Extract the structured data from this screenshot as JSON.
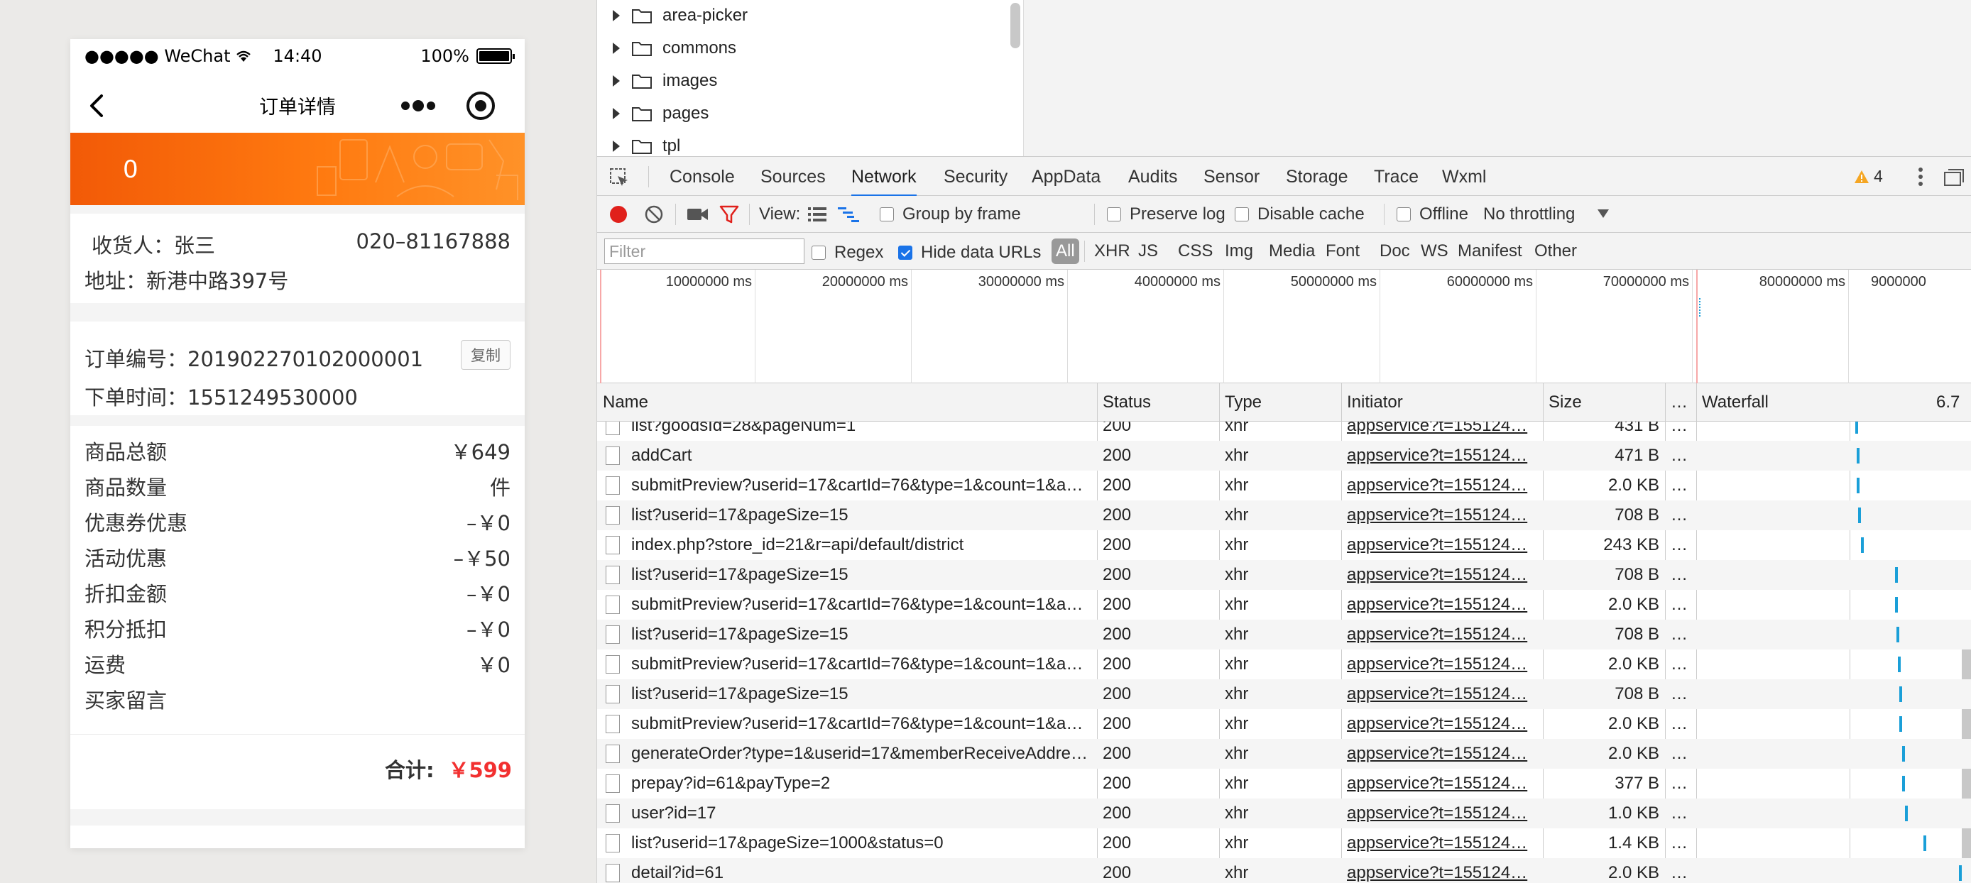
{
  "phone": {
    "carrier": "●●●●● WeChat",
    "time": "14:40",
    "battery_percent": "100%",
    "battery_level": 1.0,
    "nav_title": "订单详情",
    "banner_value": "0",
    "receiver_label": "收货人：张三",
    "receiver_phone": "020–81167888",
    "address": "地址：新港中路397号",
    "order_no": "订单编号：201902270102000001",
    "copy_button": "复制",
    "order_time": "下单时间：1551249530000",
    "summary": [
      {
        "label": "商品总额",
        "value": "￥649"
      },
      {
        "label": "商品数量",
        "value": "件"
      },
      {
        "label": "优惠券优惠",
        "value": "–￥0"
      },
      {
        "label": "活动优惠",
        "value": "–￥50"
      },
      {
        "label": "折扣金额",
        "value": "–￥0"
      },
      {
        "label": "积分抵扣",
        "value": "–￥0"
      },
      {
        "label": "运费",
        "value": "￥0"
      },
      {
        "label": "买家留言",
        "value": ""
      }
    ],
    "total_label": "合计:",
    "total_value": "￥599",
    "accent_color": "#f25a07",
    "price_color": "#f23030"
  },
  "devtools": {
    "file_tree": [
      {
        "name": "area-picker",
        "icon": "folder-icon"
      },
      {
        "name": "commons",
        "icon": "folder-icon"
      },
      {
        "name": "images",
        "icon": "folder-icon"
      },
      {
        "name": "pages",
        "icon": "folder-icon"
      },
      {
        "name": "tpl",
        "icon": "folder-icon"
      }
    ],
    "tabs": [
      "Console",
      "Sources",
      "Network",
      "Security",
      "AppData",
      "Audits",
      "Sensor",
      "Storage",
      "Trace",
      "Wxml"
    ],
    "active_tab": "Network",
    "warning_count": "4",
    "toolbar": {
      "view_label": "View:",
      "group_by_frame": "Group by frame",
      "preserve_log": "Preserve log",
      "disable_cache": "Disable cache",
      "offline": "Offline",
      "throttling": "No throttling"
    },
    "filter": {
      "placeholder": "Filter",
      "regex": "Regex",
      "hide_data_urls": "Hide data URLs",
      "hide_data_urls_checked": true,
      "types": [
        "All",
        "XHR",
        "JS",
        "CSS",
        "Img",
        "Media",
        "Font",
        "Doc",
        "WS",
        "Manifest",
        "Other"
      ]
    },
    "overview_ticks": [
      "10000000 ms",
      "20000000 ms",
      "30000000 ms",
      "40000000 ms",
      "50000000 ms",
      "60000000 ms",
      "70000000 ms",
      "80000000 ms",
      "9000000"
    ],
    "columns": {
      "name": "Name",
      "status": "Status",
      "type": "Type",
      "initiator": "Initiator",
      "size": "Size",
      "time": "…",
      "waterfall": "Waterfall",
      "waterfall_value": "6.7"
    },
    "requests": [
      {
        "name": "list?goodsId=28&pageNum=1",
        "status": "200",
        "type": "xhr",
        "initiator": "appservice?t=155124…",
        "size": "431 B",
        "time": "…"
      },
      {
        "name": "addCart",
        "status": "200",
        "type": "xhr",
        "initiator": "appservice?t=155124…",
        "size": "471 B",
        "time": "…"
      },
      {
        "name": "submitPreview?userid=17&cartId=76&type=1&count=1&a…",
        "status": "200",
        "type": "xhr",
        "initiator": "appservice?t=155124…",
        "size": "2.0 KB",
        "time": "…"
      },
      {
        "name": "list?userid=17&pageSize=15",
        "status": "200",
        "type": "xhr",
        "initiator": "appservice?t=155124…",
        "size": "708 B",
        "time": "…"
      },
      {
        "name": "index.php?store_id=21&r=api/default/district",
        "status": "200",
        "type": "xhr",
        "initiator": "appservice?t=155124…",
        "size": "243 KB",
        "time": "…"
      },
      {
        "name": "list?userid=17&pageSize=15",
        "status": "200",
        "type": "xhr",
        "initiator": "appservice?t=155124…",
        "size": "708 B",
        "time": "…"
      },
      {
        "name": "submitPreview?userid=17&cartId=76&type=1&count=1&a…",
        "status": "200",
        "type": "xhr",
        "initiator": "appservice?t=155124…",
        "size": "2.0 KB",
        "time": "…"
      },
      {
        "name": "list?userid=17&pageSize=15",
        "status": "200",
        "type": "xhr",
        "initiator": "appservice?t=155124…",
        "size": "708 B",
        "time": "…"
      },
      {
        "name": "submitPreview?userid=17&cartId=76&type=1&count=1&a…",
        "status": "200",
        "type": "xhr",
        "initiator": "appservice?t=155124…",
        "size": "2.0 KB",
        "time": "…"
      },
      {
        "name": "list?userid=17&pageSize=15",
        "status": "200",
        "type": "xhr",
        "initiator": "appservice?t=155124…",
        "size": "708 B",
        "time": "…"
      },
      {
        "name": "submitPreview?userid=17&cartId=76&type=1&count=1&a…",
        "status": "200",
        "type": "xhr",
        "initiator": "appservice?t=155124…",
        "size": "2.0 KB",
        "time": "…"
      },
      {
        "name": "generateOrder?type=1&userid=17&memberReceiveAddre…",
        "status": "200",
        "type": "xhr",
        "initiator": "appservice?t=155124…",
        "size": "2.0 KB",
        "time": "…"
      },
      {
        "name": "prepay?id=61&payType=2",
        "status": "200",
        "type": "xhr",
        "initiator": "appservice?t=155124…",
        "size": "377 B",
        "time": "…"
      },
      {
        "name": "user?id=17",
        "status": "200",
        "type": "xhr",
        "initiator": "appservice?t=155124…",
        "size": "1.0 KB",
        "time": "…"
      },
      {
        "name": "list?userid=17&pageSize=1000&status=0",
        "status": "200",
        "type": "xhr",
        "initiator": "appservice?t=155124…",
        "size": "1.4 KB",
        "time": "…"
      },
      {
        "name": "detail?id=61",
        "status": "200",
        "type": "xhr",
        "initiator": "appservice?t=155124…",
        "size": "2.0 KB",
        "time": "…"
      }
    ],
    "record_color": "#e0201b",
    "waterfall_color": "#1a9fd8"
  }
}
